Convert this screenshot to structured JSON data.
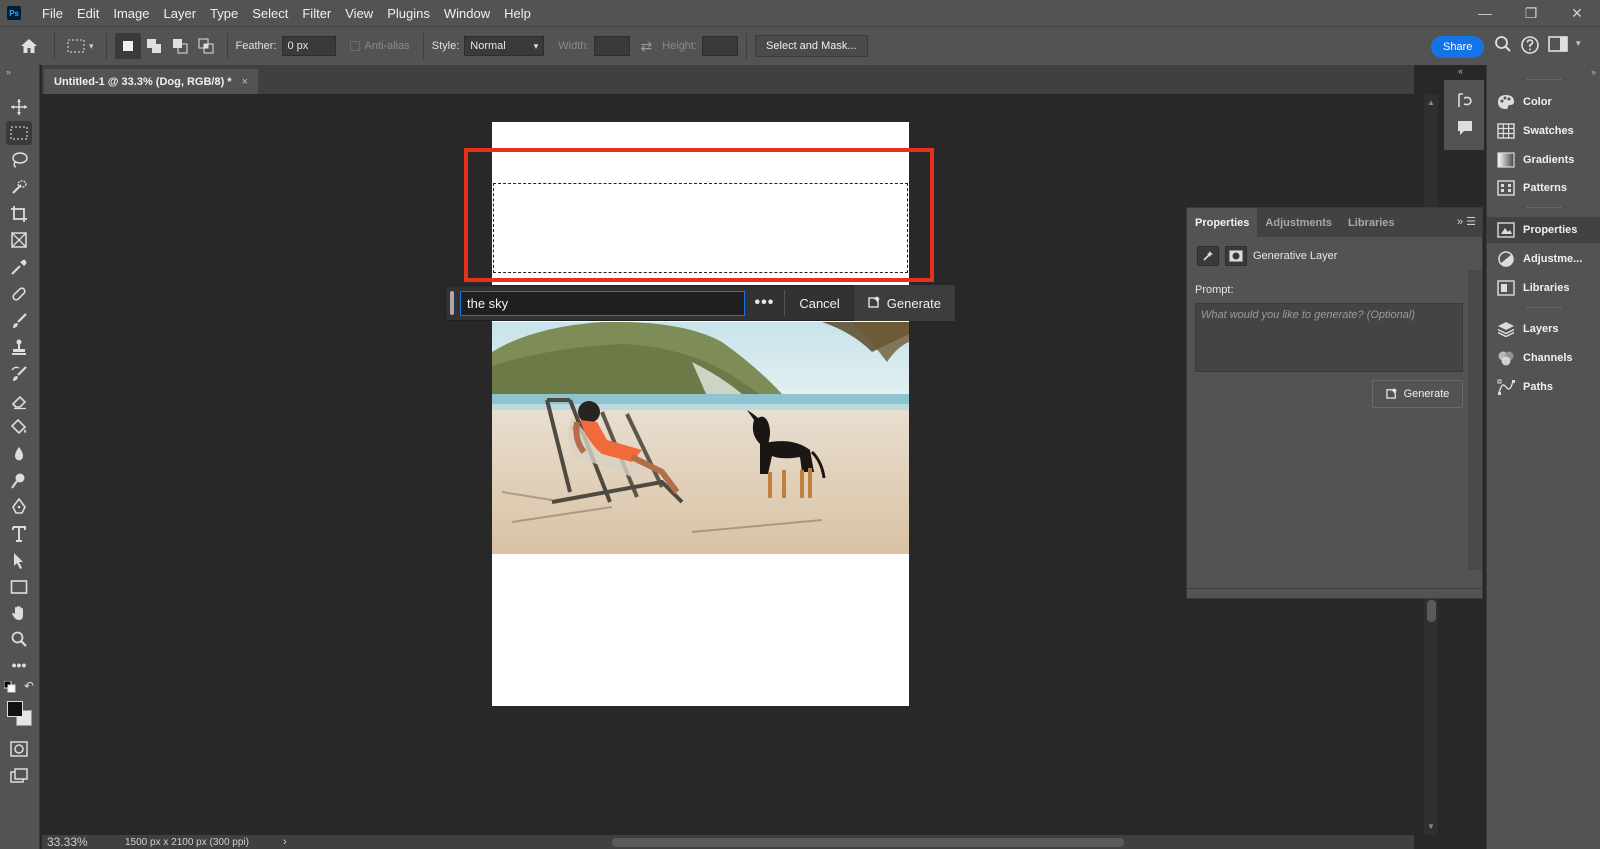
{
  "app": {
    "logo_text": "Ps"
  },
  "menu": [
    "File",
    "Edit",
    "Image",
    "Layer",
    "Type",
    "Select",
    "Filter",
    "View",
    "Plugins",
    "Window",
    "Help"
  ],
  "window_controls": {
    "minimize": "—",
    "restore": "❐",
    "close": "✕"
  },
  "options": {
    "feather_label": "Feather:",
    "feather_value": "0 px",
    "antialias_label": "Anti-alias",
    "style_label": "Style:",
    "style_value": "Normal",
    "width_label": "Width:",
    "height_label": "Height:",
    "select_mask_label": "Select and Mask...",
    "share_label": "Share"
  },
  "document": {
    "tab_title": "Untitled-1 @ 33.3% (Dog, RGB/8) *",
    "tab_close": "×"
  },
  "task_bar": {
    "prompt_value": "the sky",
    "more_label": "•••",
    "cancel_label": "Cancel",
    "generate_label": "Generate"
  },
  "status": {
    "zoom": "33.33%",
    "doc_info": "1500 px x 2100 px (300 ppi)",
    "arrow": "›"
  },
  "properties_panel": {
    "tabs": [
      "Properties",
      "Adjustments",
      "Libraries"
    ],
    "layer_type": "Generative Layer",
    "prompt_label": "Prompt:",
    "prompt_placeholder": "What would you like to generate? (Optional)",
    "generate_label": "Generate"
  },
  "dock": {
    "items": [
      "Color",
      "Swatches",
      "Gradients",
      "Patterns",
      "Properties",
      "Adjustme...",
      "Libraries",
      "Layers",
      "Channels",
      "Paths"
    ]
  },
  "colors": {
    "accent": "#1473e6",
    "highlight": "#e8311a",
    "chrome": "#535353",
    "canvas_bg": "#282828"
  }
}
